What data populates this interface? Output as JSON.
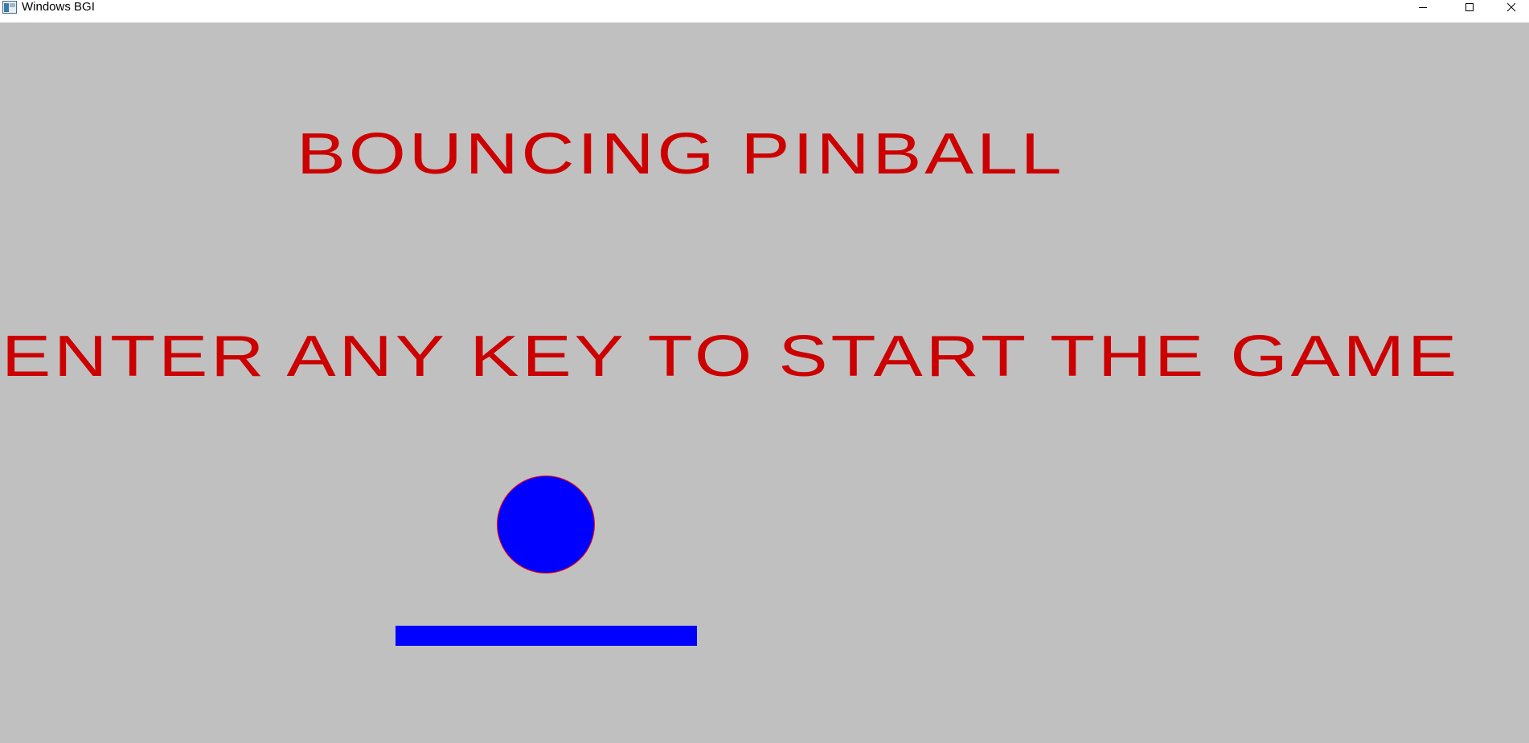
{
  "window": {
    "title": "Windows BGI",
    "controls": {
      "minimize_icon": "minimize-icon",
      "maximize_icon": "maximize-icon",
      "close_icon": "close-icon"
    }
  },
  "game": {
    "title": "BOUNCING PINBALL",
    "prompt": "ENTER ANY KEY TO START THE GAME",
    "colors": {
      "background": "#c0c0c0",
      "text": "#cc0000",
      "ball_fill": "#0000ff",
      "ball_outline": "#ff0000",
      "paddle": "#0000ff"
    }
  }
}
